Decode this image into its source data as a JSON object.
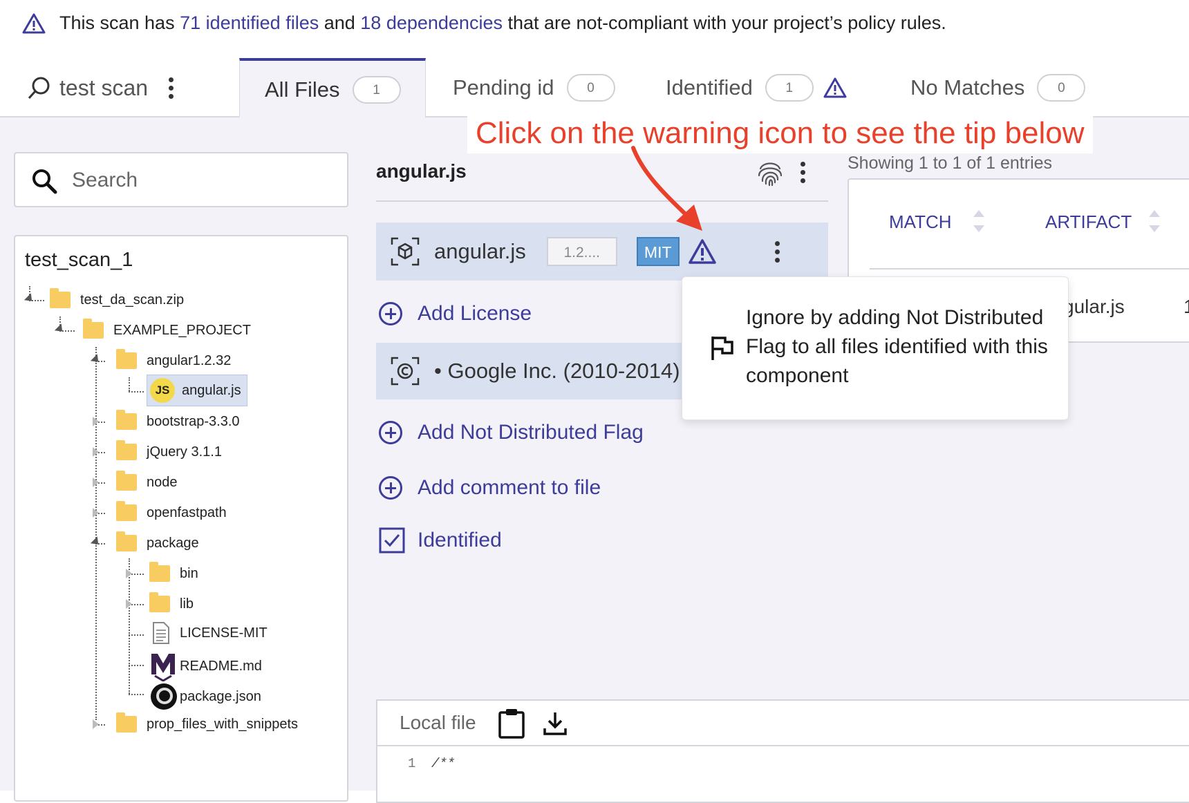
{
  "banner": {
    "pre": "This scan has ",
    "files_link": "71 identified files",
    "mid": " and ",
    "deps_link": "18 dependencies",
    "post": " that are not-compliant with your project’s policy rules."
  },
  "scan": {
    "name": "test scan"
  },
  "tabs": [
    {
      "label": "All Files",
      "count": "1"
    },
    {
      "label": "Pending id",
      "count": "0"
    },
    {
      "label": "Identified",
      "count": "1"
    },
    {
      "label": "No Matches",
      "count": "0"
    }
  ],
  "annotation": "Click on the warning icon to see the tip below",
  "search": {
    "placeholder": "Search"
  },
  "tree": {
    "root": "test_scan_1",
    "nodes": [
      "test_da_scan.zip",
      "EXAMPLE_PROJECT",
      "angular1.2.32",
      "angular.js",
      "bootstrap-3.3.0",
      "jQuery 3.1.1",
      "node",
      "openfastpath",
      "package",
      "bin",
      "lib",
      "LICENSE-MIT",
      "README.md",
      "package.json",
      "prop_files_with_snippets"
    ]
  },
  "file_panel": {
    "title": "angular.js",
    "component_name": "angular.js",
    "version": "1.2....",
    "license": "MIT",
    "add_license": "Add License",
    "copyright": "• Google Inc. (2010-2014)",
    "add_flag": "Add Not Distributed Flag",
    "add_comment": "Add comment to file",
    "identified": "Identified"
  },
  "tooltip": {
    "text": "Ignore by adding Not Distributed Flag to all files identified with this component"
  },
  "table": {
    "showing": "Showing 1 to 1 of 1 entries",
    "columns": [
      "MATCH",
      "ARTIFACT"
    ],
    "cell": "gular.js",
    "cell_extra": "1"
  },
  "local_file": {
    "label": "Local file",
    "line_no": "1",
    "line_text": "/**"
  },
  "colors": {
    "accent": "#3d3c9a",
    "annotation": "#e8402a",
    "highlight": "#d9e1f1",
    "license": "#5b9bd5"
  }
}
